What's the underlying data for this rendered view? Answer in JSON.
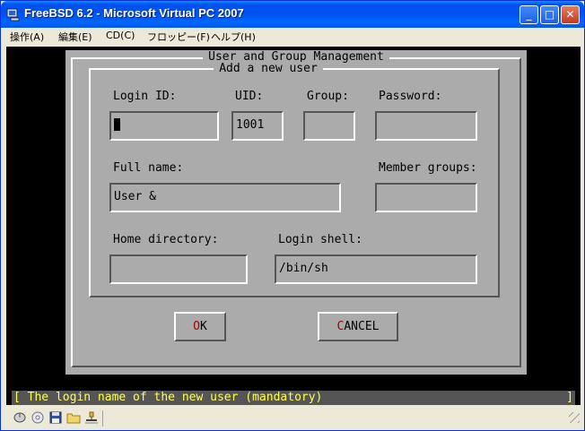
{
  "window": {
    "title": "FreeBSD 6.2 - Microsoft Virtual PC 2007",
    "controls": {
      "minimize": "_",
      "maximize": "□",
      "close": "✕"
    }
  },
  "menubar": {
    "items": [
      {
        "label": "操作(A)"
      },
      {
        "label": "編集(E)"
      },
      {
        "label": "CD(C)"
      },
      {
        "label": "フロッピー(F)"
      },
      {
        "label": "ヘルプ(H)"
      }
    ]
  },
  "dialog": {
    "title": "User and Group Management",
    "group_title": "Add a new user",
    "labels": {
      "login_id": "Login ID:",
      "uid": "UID:",
      "group": "Group:",
      "password": "Password:",
      "full_name": "Full name:",
      "member_groups": "Member groups:",
      "home_directory": "Home directory:",
      "login_shell": "Login shell:"
    },
    "values": {
      "login_id": "",
      "uid": "1001",
      "group": "",
      "password": "",
      "full_name": "User &",
      "member_groups": "",
      "home_directory": "",
      "login_shell": "/bin/sh"
    },
    "buttons": {
      "ok": {
        "hot": "O",
        "rest": "K"
      },
      "cancel": {
        "hot": "C",
        "rest": "ANCEL"
      }
    }
  },
  "statusline": {
    "text": "[ The login name of the new user (mandatory)",
    "end": "]",
    "color": "#FFFF55"
  },
  "statusbar_icons": [
    "mouse-icon",
    "cd-icon",
    "floppy-icon",
    "folder-icon",
    "network-icon"
  ]
}
